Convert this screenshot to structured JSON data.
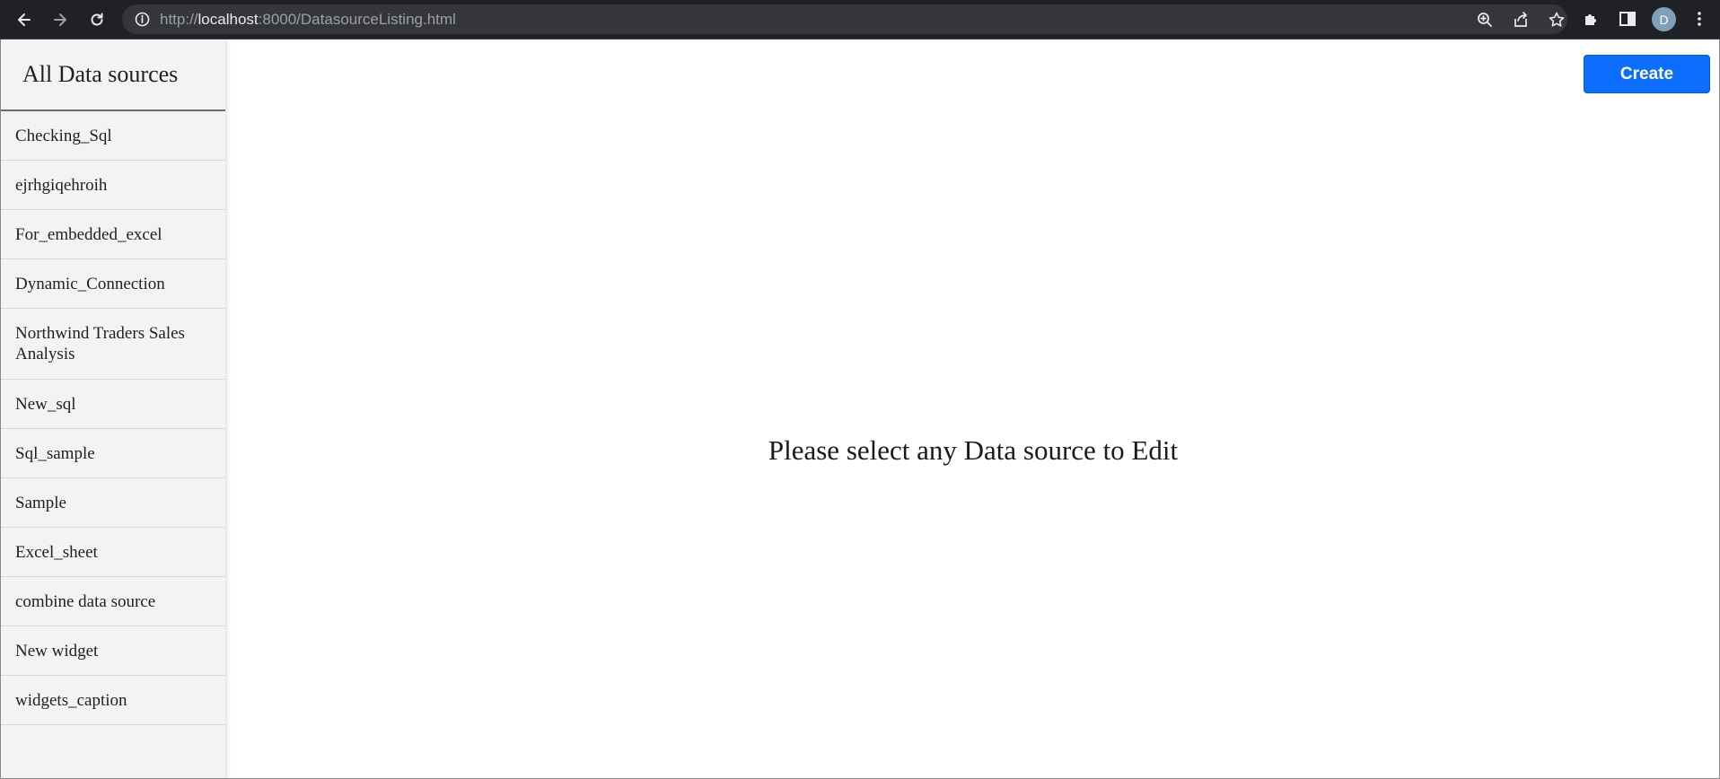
{
  "browser": {
    "url_scheme": "http://",
    "url_host": "localhost",
    "url_rest": ":8000/DatasourceListing.html",
    "profile_initial": "D",
    "icons": [
      "back-icon",
      "forward-icon",
      "reload-icon",
      "info-icon",
      "zoom-icon",
      "share-icon",
      "star-icon",
      "extensions-icon",
      "side-panel-icon",
      "menu-icon"
    ]
  },
  "sidebar": {
    "title": "All Data sources",
    "items": [
      {
        "label": "Checking_Sql"
      },
      {
        "label": "ejrhgiqehroih"
      },
      {
        "label": "For_embedded_excel"
      },
      {
        "label": "Dynamic_Connection"
      },
      {
        "label": "Northwind Traders Sales Analysis"
      },
      {
        "label": "New_sql"
      },
      {
        "label": "Sql_sample"
      },
      {
        "label": "Sample"
      },
      {
        "label": "Excel_sheet"
      },
      {
        "label": "combine data source"
      },
      {
        "label": "New widget"
      },
      {
        "label": "widgets_caption"
      }
    ]
  },
  "main": {
    "create_label": "Create",
    "placeholder": "Please select any Data source to Edit"
  },
  "colors": {
    "create_button": "#0d6efd",
    "sidebar_bg": "#f3f3f3",
    "chrome_bg": "#202124"
  }
}
